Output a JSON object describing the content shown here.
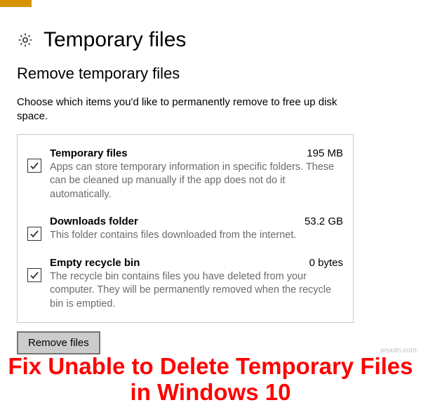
{
  "header": {
    "title": "Temporary files"
  },
  "section": {
    "title": "Remove temporary files",
    "description": "Choose which items you'd like to permanently remove to free up disk space."
  },
  "items": [
    {
      "title": "Temporary files",
      "size": "195 MB",
      "description": "Apps can store temporary information in specific folders. These can be cleaned up manually if the app does not do it automatically.",
      "checked": true
    },
    {
      "title": "Downloads folder",
      "size": "53.2 GB",
      "description": "This folder contains files downloaded from the internet.",
      "checked": true
    },
    {
      "title": "Empty recycle bin",
      "size": "0 bytes",
      "description": "The recycle bin contains files you have deleted from your computer. They will be permanently removed when the recycle bin is emptied.",
      "checked": true
    }
  ],
  "actions": {
    "remove_label": "Remove files"
  },
  "caption": "Fix Unable to Delete Temporary Files in Windows 10",
  "watermark": "wsxdn.com"
}
